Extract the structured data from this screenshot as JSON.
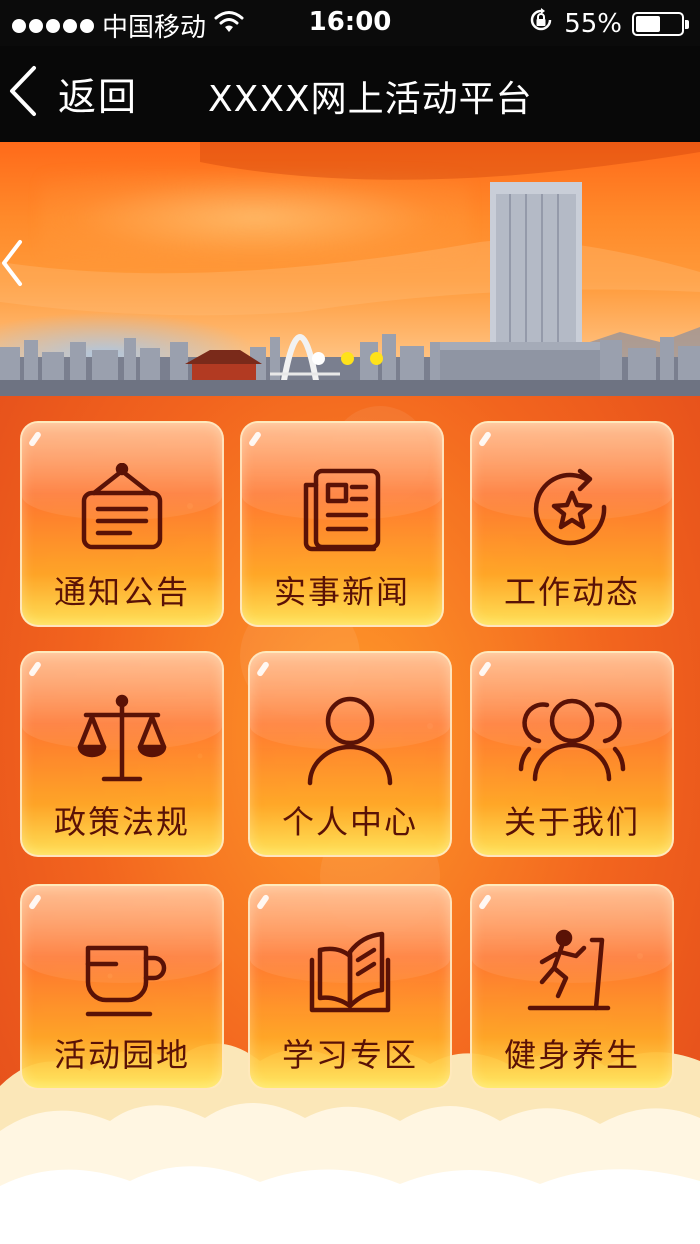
{
  "status_bar": {
    "carrier": "中国移动",
    "time": "16:00",
    "battery_percent": "55%",
    "battery_level": 0.55
  },
  "nav": {
    "back_label": "返回",
    "title": "XXXX网上活动平台"
  },
  "banner": {
    "page_count": 3,
    "active_index": 0,
    "colors": {
      "active": "#ffffff",
      "inactive": "#ffe21a"
    }
  },
  "menu": {
    "items": [
      {
        "label": "通知公告",
        "icon": "notice-board-icon"
      },
      {
        "label": "实事新闻",
        "icon": "newspaper-icon"
      },
      {
        "label": "工作动态",
        "icon": "star-refresh-icon"
      },
      {
        "label": "政策法规",
        "icon": "scales-icon"
      },
      {
        "label": "个人中心",
        "icon": "person-icon"
      },
      {
        "label": "关于我们",
        "icon": "group-icon"
      },
      {
        "label": "活动园地",
        "icon": "cup-icon"
      },
      {
        "label": "学习专区",
        "icon": "open-book-icon"
      },
      {
        "label": "健身养生",
        "icon": "treadmill-icon"
      }
    ]
  },
  "colors": {
    "icon_stroke": "#5a1206",
    "label_text": "#5a1206",
    "bar_background": "#080808"
  }
}
